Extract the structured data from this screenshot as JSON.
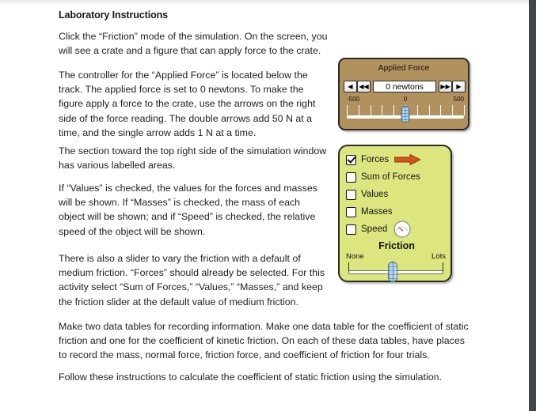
{
  "document": {
    "title": "Laboratory Instructions",
    "paragraphs": [
      "Click the “Friction” mode of the simulation. On the screen, you will see a crate and a figure that can apply force to the crate.",
      "The controller for the “Applied Force” is located below the track. The applied force is set to 0 newtons. To make the figure apply a force to the crate, use the arrows on the right side of the force reading. The double arrows add 50 N at a time, and the single arrow adds 1 N at a time.",
      "The section toward the top right side of the simulation window has various labelled areas.",
      "If “Values” is checked, the values for the forces and masses will be shown. If “Masses” is checked, the mass of each object will be shown; and if “Speed” is checked, the relative speed of the object will be shown.",
      "There is also a slider to vary the friction with a default of medium friction. “Forces” should already be selected. For this activity select “Sum of Forces,” “Values,” “Masses,” and keep the friction slider at the default value of medium friction.",
      "Make two data tables for recording information. Make one data table for the coefficient of static friction and one for the coefficient of kinetic friction. On each of these data tables, have places to record the mass, normal force, friction force, and coefficient of friction for four trials.",
      "Follow these instructions to calculate the coefficient of static friction using the simulation."
    ]
  },
  "applied_force_panel": {
    "title": "Applied Force",
    "readout_value": "0 newtons",
    "buttons": {
      "single_left": "◀",
      "double_left": "◀◀",
      "double_right": "▶▶",
      "single_right": "▶"
    },
    "scale": {
      "min": "-500",
      "mid": "0",
      "max": "500",
      "tick_count": 11,
      "thumb_value": 0
    },
    "colors": {
      "background": "#b1915e",
      "border": "#2e2a22",
      "readout_background": "#ffffff"
    }
  },
  "options_panel": {
    "checkboxes": [
      {
        "label": "Forces",
        "checked": true,
        "icon": "red-arrow-icon"
      },
      {
        "label": "Sum of Forces",
        "checked": false,
        "icon": ""
      },
      {
        "label": "Values",
        "checked": false,
        "icon": ""
      },
      {
        "label": "Masses",
        "checked": false,
        "icon": ""
      },
      {
        "label": "Speed",
        "checked": false,
        "icon": "speedometer-icon"
      }
    ],
    "friction": {
      "title": "Friction",
      "min_label": "None",
      "max_label": "Lots",
      "value_position_percent": 46
    },
    "colors": {
      "background": "#dde57f",
      "border": "#2e2a22",
      "arrow": "#d2561e",
      "slider_thumb": "#9fcbe8"
    }
  },
  "chrome": {
    "scrollbar_color": "#41464a"
  }
}
